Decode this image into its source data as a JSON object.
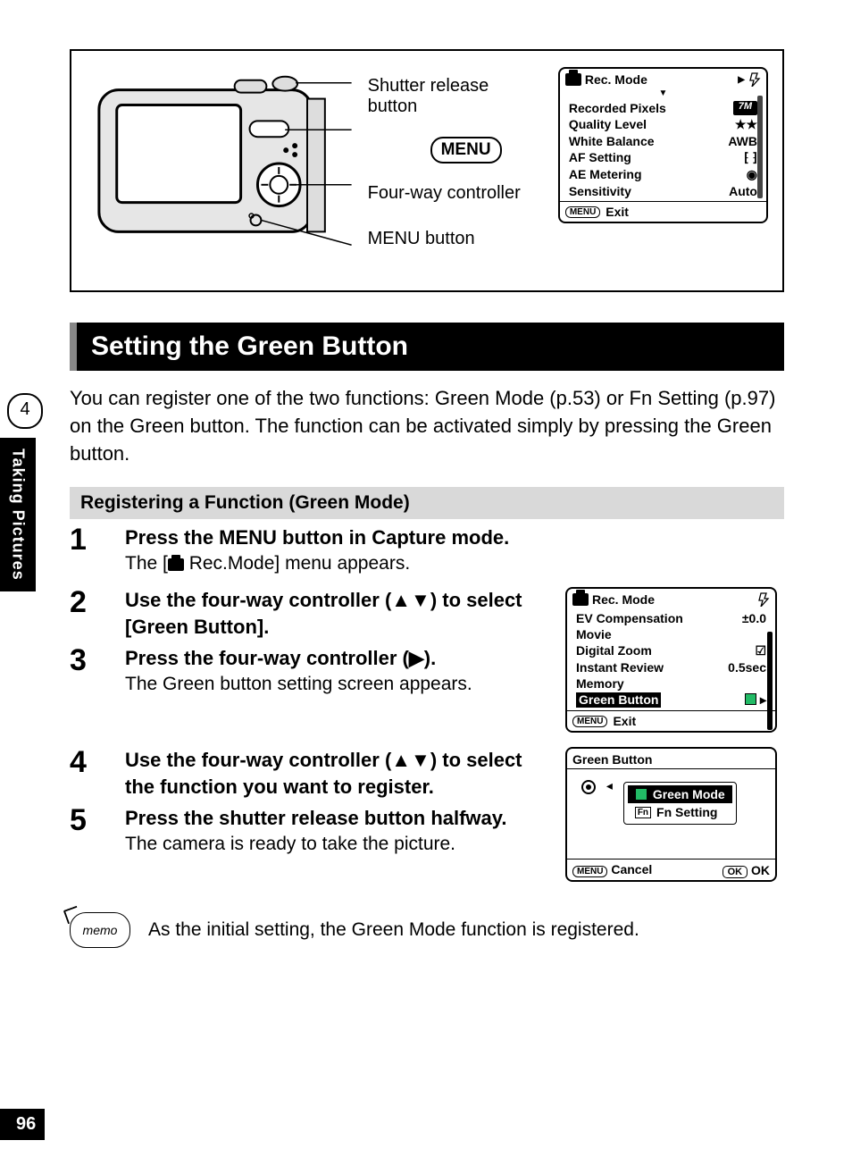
{
  "side": {
    "chapter": "4",
    "label": "Taking Pictures"
  },
  "page_number": "96",
  "diagram": {
    "labels": {
      "shutter": "Shutter release button",
      "fourway": "Four-way controller",
      "menubtn": "MENU button",
      "menu_pill": "MENU"
    }
  },
  "lcd_top": {
    "title": "Rec. Mode",
    "rows": [
      {
        "label": "Recorded Pixels",
        "value": "7M"
      },
      {
        "label": "Quality Level",
        "value": "★★"
      },
      {
        "label": "White Balance",
        "value": "AWB"
      },
      {
        "label": "AF Setting",
        "value": "[  ]"
      },
      {
        "label": "AE Metering",
        "value": "◉"
      },
      {
        "label": "Sensitivity",
        "value": "Auto"
      }
    ],
    "footer_menu": "MENU",
    "footer_text": "Exit"
  },
  "section_title": "Setting the Green Button",
  "intro": "You can register one of the two functions: Green Mode (p.53) or Fn Setting (p.97) on the Green button. The function can be activated simply by pressing the Green button.",
  "sub_header": "Registering a Function (Green Mode)",
  "steps": {
    "s1": {
      "num": "1",
      "title": "Press the MENU button in Capture mode.",
      "sub_pre": "The [",
      "sub_post": " Rec.Mode] menu appears."
    },
    "s2": {
      "num": "2",
      "title": "Use the four-way controller (▲▼) to select [Green Button]."
    },
    "s3": {
      "num": "3",
      "title": "Press the four-way controller (▶).",
      "sub": "The Green button setting screen appears."
    },
    "s4": {
      "num": "4",
      "title": "Use the four-way controller (▲▼) to select the function you want to register."
    },
    "s5": {
      "num": "5",
      "title": "Press the shutter release button halfway.",
      "sub": "The camera is ready to take the picture."
    }
  },
  "lcd2": {
    "title": "Rec. Mode",
    "rows": [
      {
        "label": "EV Compensation",
        "value": "±0.0"
      },
      {
        "label": "Movie",
        "value": ""
      },
      {
        "label": "Digital Zoom",
        "value": "☑"
      },
      {
        "label": "Instant Review",
        "value": "0.5sec"
      },
      {
        "label": "Memory",
        "value": ""
      },
      {
        "label": "Green Button",
        "value": "▶",
        "hl": true
      }
    ],
    "footer_menu": "MENU",
    "footer_text": "Exit"
  },
  "lcd3": {
    "title": "Green Button",
    "options": [
      {
        "label": "Green Mode",
        "selected": true
      },
      {
        "label": "Fn Setting",
        "fn": true
      }
    ],
    "footer_menu": "MENU",
    "cancel": "Cancel",
    "ok_box": "OK",
    "ok": "OK"
  },
  "memo": "As the initial setting, the Green Mode function is registered.",
  "memo_label": "memo"
}
